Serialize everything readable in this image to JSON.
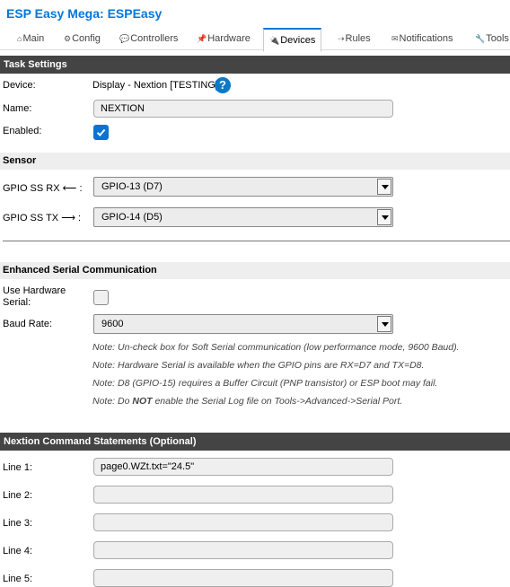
{
  "app": {
    "title": "ESP Easy Mega: ESPEasy"
  },
  "tabs": [
    {
      "icon": "⌂",
      "label": "Main",
      "active": false
    },
    {
      "icon": "⚙",
      "label": "Config",
      "active": false
    },
    {
      "icon": "💬",
      "label": "Controllers",
      "active": false
    },
    {
      "icon": "📌",
      "label": "Hardware",
      "active": false
    },
    {
      "icon": "🔌",
      "label": "Devices",
      "active": true
    },
    {
      "icon": "⇢",
      "label": "Rules",
      "active": false
    },
    {
      "icon": "✉",
      "label": "Notifications",
      "active": false
    },
    {
      "icon": "🔧",
      "label": "Tools",
      "active": false
    }
  ],
  "task_settings": {
    "header": "Task Settings",
    "device_label": "Device:",
    "device_value": "Display - Nextion [TESTING]",
    "help_icon": "?",
    "name_label": "Name:",
    "name_value": "NEXTION",
    "enabled_label": "Enabled:",
    "enabled": true
  },
  "sensor": {
    "header": "Sensor",
    "rx_label": "GPIO SS RX ⟵ :",
    "rx_value": "GPIO-13 (D7)",
    "tx_label": "GPIO SS TX ⟶ :",
    "tx_value": "GPIO-14 (D5)"
  },
  "serial": {
    "header": "Enhanced Serial Communication",
    "hw_serial_label": "Use Hardware Serial:",
    "hw_serial": false,
    "baud_label": "Baud Rate:",
    "baud_value": "9600",
    "note1": "Note: Un-check box for Soft Serial communication (low performance mode, 9600 Baud).",
    "note2": "Note: Hardware Serial is available when the GPIO pins are RX=D7 and TX=D8.",
    "note3": "Note: D8 (GPIO-15) requires a Buffer Circuit (PNP transistor) or ESP boot may fail.",
    "note4_pre": "Note: Do ",
    "note4_bold": "NOT",
    "note4_post": " enable the Serial Log file on Tools->Advanced->Serial Port."
  },
  "commands": {
    "header": "Nextion Command Statements (Optional)",
    "lines": [
      {
        "label": "Line 1:",
        "value": "page0.WZt.txt=\"24.5\""
      },
      {
        "label": "Line 2:",
        "value": ""
      },
      {
        "label": "Line 3:",
        "value": ""
      },
      {
        "label": "Line 4:",
        "value": ""
      },
      {
        "label": "Line 5:",
        "value": ""
      }
    ]
  },
  "colors": {
    "accent": "#0077dd",
    "section_header_bg": "#444444",
    "subheader_bg": "#eeeeee",
    "checkbox_checked": "#0a73d3"
  },
  "icons": {
    "help": "help-circle-icon",
    "checkmark": "checkmark-icon",
    "dropdown": "chevron-down-icon"
  }
}
